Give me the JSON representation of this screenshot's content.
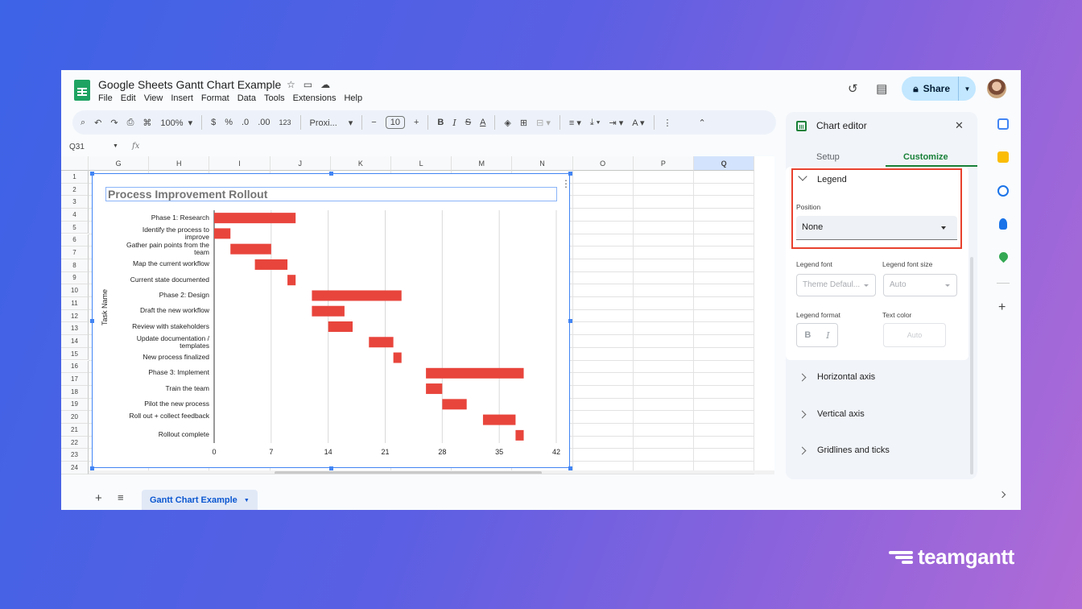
{
  "app": {
    "doc_title": "Google Sheets Gantt Chart Example",
    "menu": [
      "File",
      "Edit",
      "View",
      "Insert",
      "Format",
      "Data",
      "Tools",
      "Extensions",
      "Help"
    ],
    "share_label": "Share"
  },
  "toolbar": {
    "zoom": "100%",
    "currency": "$",
    "percent": "%",
    "dec_less": ".0",
    "dec_more": ".00",
    "num_format": "123",
    "font": "Proxi...",
    "font_size": "10"
  },
  "formula_bar": {
    "cell_ref": "Q31",
    "fx": "fx"
  },
  "grid": {
    "columns": [
      "G",
      "H",
      "I",
      "J",
      "K",
      "L",
      "M",
      "N",
      "O",
      "P",
      "Q"
    ],
    "rows": [
      "1",
      "2",
      "3",
      "4",
      "5",
      "6",
      "7",
      "8",
      "9",
      "10",
      "11",
      "12",
      "13",
      "14",
      "15",
      "16",
      "17",
      "18",
      "19",
      "20",
      "21",
      "22",
      "23",
      "24"
    ],
    "selected_column": "Q"
  },
  "chart_data": {
    "type": "bar",
    "title": "Process Improvement Rollout",
    "ylabel": "Task Name",
    "xlabel": "",
    "xlim": [
      0,
      42
    ],
    "xticks": [
      "0",
      "7",
      "14",
      "21",
      "28",
      "35",
      "42"
    ],
    "grid": true,
    "legend": "none",
    "bar_color": "#e8453c",
    "tasks": [
      {
        "name": "Phase 1: Research",
        "start": 0,
        "end": 10
      },
      {
        "name": "Identify the process to improve",
        "start": 0,
        "end": 2
      },
      {
        "name": "Gather pain points from the team",
        "start": 2,
        "end": 7
      },
      {
        "name": "Map the current workflow",
        "start": 5,
        "end": 9
      },
      {
        "name": "Current state documented",
        "start": 9,
        "end": 10
      },
      {
        "name": "Phase 2: Design",
        "start": 12,
        "end": 23
      },
      {
        "name": "Draft the new workflow",
        "start": 12,
        "end": 16
      },
      {
        "name": "Review with stakeholders",
        "start": 14,
        "end": 17
      },
      {
        "name": "Update documentation / templates",
        "start": 19,
        "end": 22
      },
      {
        "name": "New process finalized",
        "start": 22,
        "end": 23
      },
      {
        "name": "Phase 3: Implement",
        "start": 26,
        "end": 38
      },
      {
        "name": "Train the team",
        "start": 26,
        "end": 28
      },
      {
        "name": "Pilot the new process",
        "start": 28,
        "end": 31
      },
      {
        "name": "Roll out + collect feedback",
        "start": 33,
        "end": 37
      },
      {
        "name": "Rollout complete",
        "start": 37,
        "end": 38
      }
    ]
  },
  "sheet_tabs": {
    "active": "Gantt Chart Example"
  },
  "editor": {
    "title": "Chart editor",
    "tab_setup": "Setup",
    "tab_customize": "Customize",
    "legend": {
      "heading": "Legend",
      "position_label": "Position",
      "position_value": "None",
      "font_label": "Legend font",
      "font_value": "Theme Defaul...",
      "font_size_label": "Legend font size",
      "font_size_value": "Auto",
      "format_label": "Legend format",
      "bold": "B",
      "italic": "I",
      "text_color_label": "Text color",
      "text_color_value": "Auto"
    },
    "sections": [
      "Horizontal axis",
      "Vertical axis",
      "Gridlines and ticks"
    ]
  },
  "brand": {
    "name": "teamgantt"
  },
  "colors": {
    "accent": "#188038",
    "highlight": "#e8412e",
    "bar": "#e8453c",
    "selection": "#4285f4"
  }
}
